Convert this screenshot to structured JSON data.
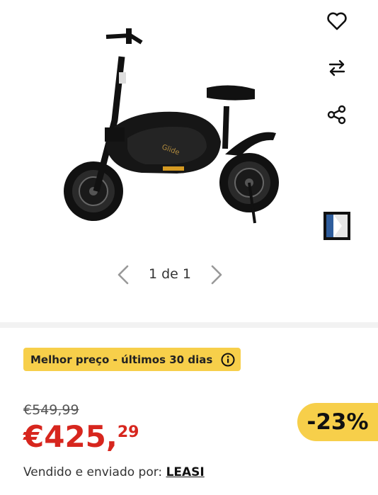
{
  "gallery": {
    "pager_text": "1 de 1",
    "icons": [
      "heart-icon",
      "compare-icon",
      "share-icon",
      "app-thumbnail-icon"
    ]
  },
  "badge": {
    "text": "Melhor preço - últimos 30 dias"
  },
  "pricing": {
    "old_price": "€549,99",
    "price_main": "€425,",
    "price_cents": "29",
    "discount": "-23%",
    "accent_color": "#d7261e",
    "badge_color": "#f7cf4a"
  },
  "seller": {
    "prefix": "Vendido e enviado por:",
    "name": "LEASI"
  }
}
